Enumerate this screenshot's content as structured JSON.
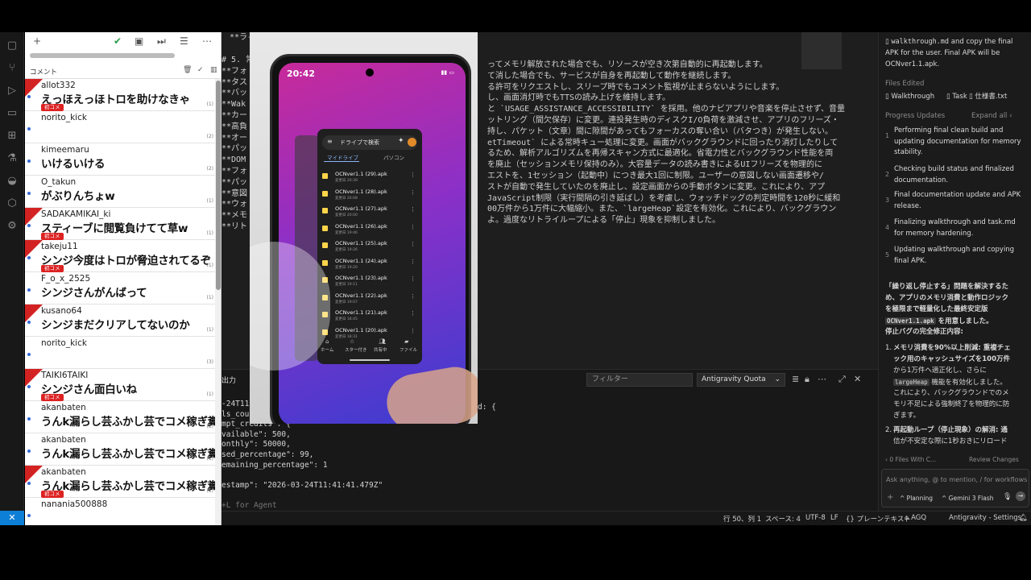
{
  "editor": {
    "lines": [
      {
        "text": "# 5. 常",
        "color": "#cfcfcf"
      },
      {
        "text": "  **フォ",
        "color": "#cfcfcf"
      },
      {
        "text": "  **タス",
        "color": "#cfcfcf"
      },
      {
        "text": "  **バッ",
        "color": "#cfcfcf"
      },
      {
        "text": "  **Wak",
        "color": "#cfcfcf"
      },
      {
        "text": "  **カー",
        "color": "#cfcfcf"
      },
      {
        "text": "  **高負",
        "color": "#cfcfcf"
      },
      {
        "text": "  **オー",
        "color": "#cfcfcf"
      },
      {
        "text": "  **パッ",
        "color": "#cfcfcf"
      },
      {
        "text": "  **DOM",
        "color": "#cfcfcf"
      },
      {
        "text": "  **フォ",
        "color": "#cfcfcf"
      },
      {
        "text": "  **パッ",
        "color": "#cfcfcf"
      },
      {
        "text": "  **意図",
        "color": "#cfcfcf"
      },
      {
        "text": "  **ウォ",
        "color": "#cfcfcf"
      },
      {
        "text": "  **メモ",
        "color": "#cfcfcf"
      },
      {
        "text": "  **リト",
        "color": "#cfcfcf"
      }
    ],
    "top_line": "**ラ-アイコンを採用。",
    "right_lines": [
      "ってメモリ解放された場合でも、リソースが空き次第自動的に再起動します。",
      "て消した場合でも、サービスが自身を再起動して動作を継続します。",
      "る許可をリクエストし、スリープ時でもコメント監視が止まらないようにします。",
      "し、画面消灯時でもTTSの読み上げを維持します。",
      "と `USAGE_ASSISTANCE_ACCESSIBILITY` を採用。他のナビアプリや音楽を停止させず、音量",
      "ットリング（間欠保存）に変更。連投発生時のディスクI/O負荷を激減させ、アプリのフリーズ・",
      "持し、パケット（文章）間に隙間があってもフォーカスの奪い合い（バタつき）が発生しない。",
      "etTimeout` による常時キュー処理に変更。画面がバックグラウンドに回ったり消灯したりして",
      "るため、解析アルゴリズムを再帰スキャン方式に最適化。省電力性とバックグラウンド性能を両",
      "を廃止（セッションメモリ保持のみ）。大容量データの読み書きによるUIフリーズを物理的に",
      "エストを、1セッション（起動中）につき最大1回に制限。ユーザーの意図しない画面遷移や/",
      "ストが自動で発生していたのを廃止し、設定画面からの手動ボタンに変更。これにより、アプ",
      "JavaScript制限（実行間隔の引き延ばし）を考慮し、ウォッチドッグの判定時間を120秒に緩和",
      "00万件から1万件に大幅縮小。また、`largeHeap`設定を有効化。これにより、バックグラウン",
      "よ。過度なリトライループによる「停止」現象を抑制しました。"
    ]
  },
  "panel": {
    "tab_label": "出力",
    "filter_placeholder": "フィルター",
    "quota_select": "Antigravity Quota",
    "lines": [
      "-24T11",
      "ls_cou",
      "mpt_credits\": {",
      "vailable\": 500,",
      "onthly\": 50000,",
      "sed_percentage\": 99,",
      "emaining_percentage\": 1",
      "",
      "estamp\": \"2026-03-24T11:41:41.479Z\"",
      "",
      "+L for Agent"
    ],
    "right_fragment": "d: {"
  },
  "agent": {
    "walkthrough_line1": "walkthrough.md",
    "walkthrough_line1b": " and copy the final",
    "walkthrough_line2": "APK for the user. Final APK will be",
    "walkthrough_line3": "OCNver1.1.apk.",
    "files_edited_label": "Files Edited",
    "files": [
      "Walkthrough",
      "Task",
      "仕様書.txt"
    ],
    "progress_label": "Progress Updates",
    "expand_all": "Expand all",
    "steps": [
      {
        "num": "1",
        "text": "Performing final clean build and updating documentation for memory stability."
      },
      {
        "num": "2",
        "text": "Checking build status and finalized documentation."
      },
      {
        "num": "3",
        "text": "Final documentation update and APK release."
      },
      {
        "num": "4",
        "text": "Finalizing walkthrough and task.md for memory hardening."
      },
      {
        "num": "5",
        "text": "Updating walkthrough and copying final APK."
      }
    ],
    "summary_1": "「繰り返し停止する」問題を解決するた",
    "summary_2": "め、アプリのメモリ消費と動作ロジック",
    "summary_3": "を極限まで軽量化した最終安定版",
    "summary_apk": "OCNver1.1.apk",
    "summary_4": " を用意しました。",
    "summary_5": "停止バグの完全修正内容:",
    "item1_1": "メモリ消費を90%以上削減: 重複チェ",
    "item1_2": "ック用のキャッシュサイズを100万件",
    "item1_3": "から1万件へ適正化し、さらに",
    "item1_code": "largeHeap",
    "item1_4": " 機能を有効化しました。",
    "item1_5": "これにより、バックグラウンドでのメ",
    "item1_6": "モリ不足による強制終了を物理的に防",
    "item1_7": "ぎます。",
    "item2_1": "再起動ループ（停止現象）の解消: 通",
    "item2_2": "信が不安定な際に1秒おきにリロード",
    "files_changed": "0 Files With C...",
    "review_changes": "Review Changes",
    "ask_placeholder": "Ask anything, @ to mention, / for workflows",
    "mode": "Planning",
    "model": "Gemini 3 Flash"
  },
  "statusbar": {
    "position": "行 50、列 1",
    "spaces": "スペース: 4",
    "encoding": "UTF-8",
    "eol": "LF",
    "lang": "{} プレーンテキスト",
    "agq": "AGQ",
    "settings": "Antigravity - Settings"
  },
  "comments": {
    "header": "コメント",
    "items": [
      {
        "name": "allot332",
        "text": "えっほえっほトロを助けなきゃ",
        "badge": "初コメ",
        "count": "(1)",
        "new": true
      },
      {
        "name": "norito_kick",
        "text": "",
        "badge": "",
        "count": "(2)",
        "new": false
      },
      {
        "name": "kimeemaru",
        "text": "いけるいける",
        "badge": "",
        "count": "(2)",
        "new": false
      },
      {
        "name": "O_takun",
        "text": "がぶりんちょw",
        "badge": "",
        "count": "(1)",
        "new": false
      },
      {
        "name": "SADAKAMIKAI_ki",
        "text": "スティーブに閲覧負けてて草w",
        "badge": "初コメ",
        "count": "(1)",
        "new": true
      },
      {
        "name": "takeju11",
        "text": "シンジ今度はトロが脅迫されてるぞ",
        "badge": "初コメ",
        "count": "(1)",
        "new": true
      },
      {
        "name": "F_o_x_2525",
        "text": "シンジさんがんばって",
        "badge": "",
        "count": "(1)",
        "new": false
      },
      {
        "name": "kusano64",
        "text": "シンジまだクリアしてないのか",
        "badge": "",
        "count": "(1)",
        "new": true
      },
      {
        "name": "norito_kick",
        "text": "",
        "badge": "",
        "count": "(3)",
        "new": false
      },
      {
        "name": "TAIKI6TAIKI",
        "text": "シンジさん面白いね",
        "badge": "初コメ",
        "count": "(1)",
        "new": true
      },
      {
        "name": "akanbaten",
        "text": "うんk漏らし芸ふかし芸でコメ稼ぎ糞芸おったん！+ビリグソ漏らし芸！",
        "badge": "",
        "count": "(1)",
        "new": false
      },
      {
        "name": "akanbaten",
        "text": "うんk漏らし芸ふかし芸でコメ稼ぎ糞芸おったん！+ビリグソ漏らし芸！",
        "badge": "",
        "count": "(1)",
        "new": false
      },
      {
        "name": "akanbaten",
        "text": "うんk漏らし芸ふかし芸でコメ稼ぎ糞芸おったん！+ビリグソ漏らし芸！",
        "badge": "初コメ",
        "count": "(1)",
        "new": true
      },
      {
        "name": "nanania500888",
        "text": "",
        "badge": "",
        "count": "",
        "new": false
      }
    ]
  },
  "phone": {
    "time": "20:42",
    "search": "ドライブで検索",
    "tab_mydrive": "マイドライブ",
    "tab_pc": "パソコン",
    "files": [
      {
        "name": "OCNver1.1 (29).apk",
        "sub": "変更日 20:39"
      },
      {
        "name": "OCNver1.1 (28).apk",
        "sub": "変更日 20:08"
      },
      {
        "name": "OCNver1.1 (27).apk",
        "sub": "変更日 20:00"
      },
      {
        "name": "OCNver1.1 (26).apk",
        "sub": "変更日 19:46"
      },
      {
        "name": "OCNver1.1 (25).apk",
        "sub": "変更日 19:26"
      },
      {
        "name": "OCNver1.1 (24).apk",
        "sub": "変更日 19:20"
      },
      {
        "name": "OCNver1.1 (23).apk",
        "sub": "変更日 19:11"
      },
      {
        "name": "OCNver1.1 (22).apk",
        "sub": "変更日 19:07"
      },
      {
        "name": "OCNver1.1 (21).apk",
        "sub": "変更日 18:45"
      },
      {
        "name": "OCNver1.1 (20).apk",
        "sub": "変更日 18:31"
      }
    ],
    "nav": [
      "ホーム",
      "スター付き",
      "共有中",
      "ファイル"
    ]
  }
}
